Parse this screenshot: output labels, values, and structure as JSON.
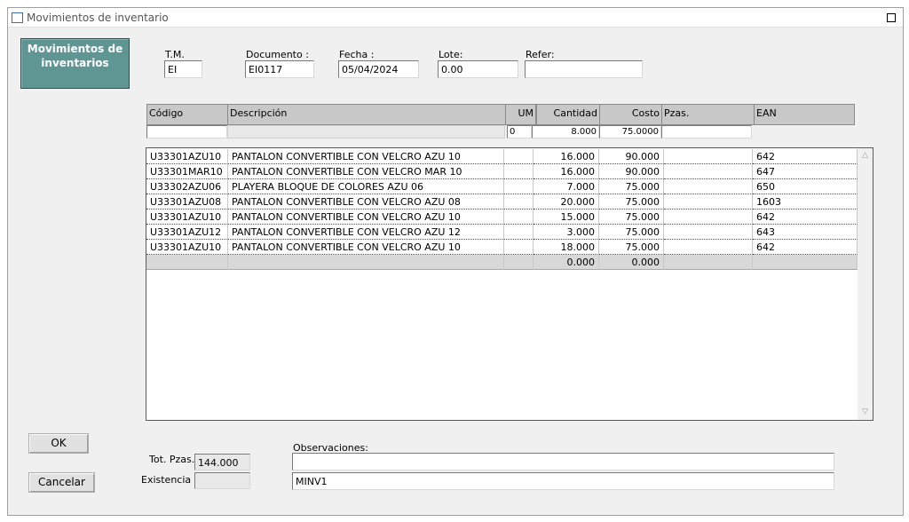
{
  "window": {
    "title": "Movimientos de inventario",
    "icon": "window-icon",
    "maximize_icon": "maximize-icon"
  },
  "module_button": {
    "label_line1": "Movimientos de",
    "label_line2": "inventarios"
  },
  "header_fields": {
    "tm": {
      "label": "T.M.",
      "value": "EI"
    },
    "documento": {
      "label": "Documento :",
      "value": "EI0117"
    },
    "fecha": {
      "label": "Fecha :",
      "value": "05/04/2024"
    },
    "lote": {
      "label": "Lote:",
      "value": "0.00"
    },
    "refer": {
      "label": "Refer:",
      "value": ""
    }
  },
  "columns": {
    "codigo": "Código",
    "descripcion": "Descripción",
    "um": "UM",
    "cantidad": "Cantidad",
    "costo": "Costo",
    "pzas": "Pzas.",
    "ean": "EAN"
  },
  "entry_row": {
    "codigo": "",
    "descripcion": "",
    "um": "0",
    "cantidad": "8.000",
    "costo": "75.0000",
    "pzas": ""
  },
  "rows": [
    {
      "codigo": "U33301AZU10",
      "descripcion": "PANTALON CONVERTIBLE CON VELCRO AZU 10",
      "um": "",
      "cantidad": "16.000",
      "costo": "90.000",
      "pzas": "",
      "ean": "642"
    },
    {
      "codigo": "U33301MAR10",
      "descripcion": "PANTALON CONVERTIBLE CON VELCRO MAR 10",
      "um": "",
      "cantidad": "16.000",
      "costo": "90.000",
      "pzas": "",
      "ean": "647"
    },
    {
      "codigo": "U33302AZU06",
      "descripcion": "PLAYERA BLOQUE DE COLORES AZU 06",
      "um": "",
      "cantidad": "7.000",
      "costo": "75.000",
      "pzas": "",
      "ean": "650"
    },
    {
      "codigo": "U33301AZU08",
      "descripcion": "PANTALON CONVERTIBLE CON VELCRO AZU 08",
      "um": "",
      "cantidad": "20.000",
      "costo": "75.000",
      "pzas": "",
      "ean": "1603"
    },
    {
      "codigo": "U33301AZU10",
      "descripcion": "PANTALON CONVERTIBLE CON VELCRO AZU 10",
      "um": "",
      "cantidad": "15.000",
      "costo": "75.000",
      "pzas": "",
      "ean": "642"
    },
    {
      "codigo": "U33301AZU12",
      "descripcion": "PANTALON CONVERTIBLE CON VELCRO AZU 12",
      "um": "",
      "cantidad": "3.000",
      "costo": "75.000",
      "pzas": "",
      "ean": "643"
    },
    {
      "codigo": "U33301AZU10",
      "descripcion": "PANTALON CONVERTIBLE CON VELCRO AZU 10",
      "um": "",
      "cantidad": "18.000",
      "costo": "75.000",
      "pzas": "",
      "ean": "642"
    }
  ],
  "total_row": {
    "cantidad": "0.000",
    "costo": "0.000"
  },
  "scroll": {
    "up_icon": "scroll-up-icon",
    "down_icon": "scroll-down-icon"
  },
  "buttons": {
    "ok": "OK",
    "cancelar": "Cancelar"
  },
  "totals": {
    "tot_pzas_label": "Tot. Pzas.",
    "tot_pzas_value": "144.000",
    "existencia_label": "Existencia :",
    "existencia_value": ""
  },
  "observaciones": {
    "label": "Observaciones:",
    "line1": "",
    "line2": "MINV1"
  },
  "colors": {
    "module_button": "#5f9694",
    "header_row": "#c8c8c8",
    "window_bg": "#f0f0f0"
  }
}
